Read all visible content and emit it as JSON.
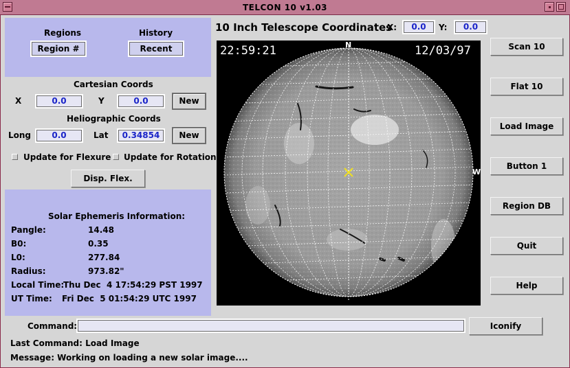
{
  "window": {
    "title": "TELCON 10 v1.03"
  },
  "left_top": {
    "regions_label": "Regions",
    "regions_button": "Region #",
    "history_label": "History",
    "history_button": "Recent"
  },
  "cartesian": {
    "title": "Cartesian Coords",
    "x_label": "X",
    "x_value": "0.0",
    "y_label": "Y",
    "y_value": "0.0",
    "new_label": "New"
  },
  "heliographic": {
    "title": "Heliographic Coords",
    "long_label": "Long",
    "long_value": "0.0",
    "lat_label": "Lat",
    "lat_value": "0.34854",
    "new_label": "New"
  },
  "options": {
    "flexure_label": "Update for Flexure",
    "rotation_label": "Update for Rotation",
    "disp_flex_label": "Disp. Flex."
  },
  "ephemeris": {
    "title": "Solar Ephemeris Information:",
    "rows": [
      {
        "label": "Pangle:",
        "value": "14.48"
      },
      {
        "label": "B0:",
        "value": "0.35"
      },
      {
        "label": "L0:",
        "value": "277.84"
      },
      {
        "label": "Radius:",
        "value": "973.82\""
      }
    ],
    "local_label": "Local Time:",
    "local_value": "Thu Dec  4 17:54:29 PST 1997",
    "ut_label": "UT Time:",
    "ut_value": "Fri Dec  5 01:54:29 UTC 1997"
  },
  "telescope": {
    "title": "10 Inch Telescope Coordinates",
    "x_label": "X:",
    "x_value": "0.0",
    "y_label": "Y:",
    "y_value": "0.0"
  },
  "image": {
    "time_overlay": "22:59:21",
    "date_overlay": "12/03/97",
    "north_label": "N",
    "west_label": "W"
  },
  "right_buttons": [
    "Scan 10",
    "Flat 10",
    "Load Image",
    "Button 1",
    "Region DB",
    "Quit",
    "Help"
  ],
  "command": {
    "label": "Command:",
    "value": "",
    "iconify_label": "Iconify",
    "last_command": "Last Command: Load Image",
    "message": "Message: Working on loading a new solar image...."
  },
  "colors": {
    "panel": "#b8b8ec",
    "title_bar": "#c07a92",
    "field_text": "#1a24c8",
    "cursor_marker": "#f0e020"
  }
}
